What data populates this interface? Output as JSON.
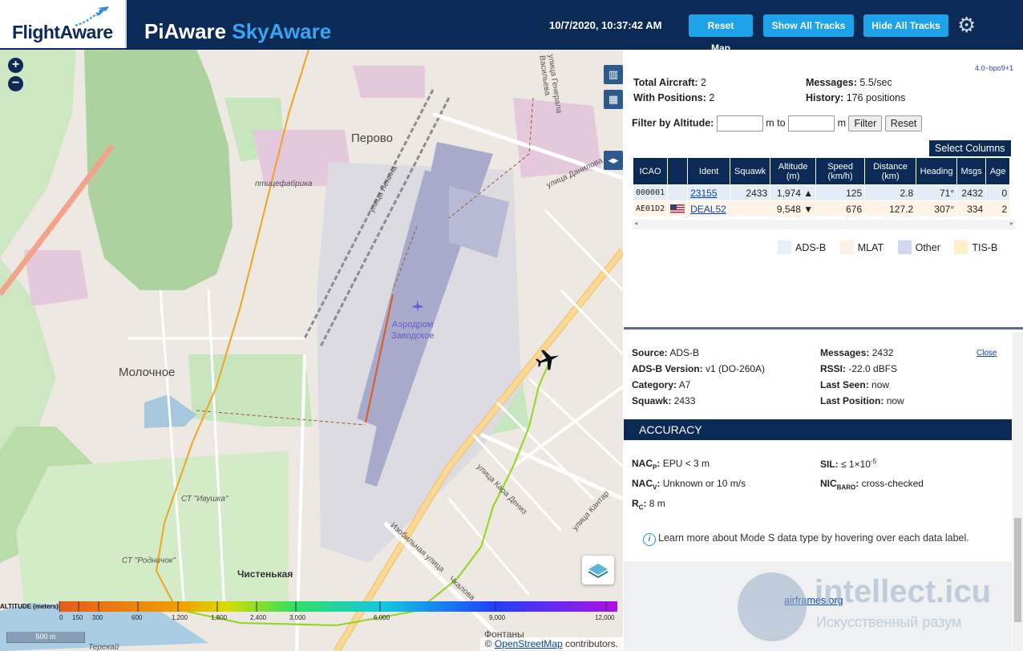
{
  "header": {
    "logo_text": "FlightAware",
    "title_a": "PiAware",
    "title_b": "SkyAware",
    "clock": "10/7/2020, 10:37:42 AM",
    "reset_map": "Reset Map",
    "show_all_tracks": "Show All Tracks",
    "hide_all_tracks": "Hide All Tracks"
  },
  "map": {
    "zoom_in": "+",
    "zoom_out": "−",
    "places": {
      "perovo": "Перово",
      "ptitsefabrika": "птицефабрика",
      "molochnoe": "Молочное",
      "ivushka": "СТ \"Ивушка\"",
      "rodnichok": "СТ \"Родничок\"",
      "chistenkaya": "Чистенькая",
      "fontany": "Фонтаны",
      "terekay": "Терекай"
    },
    "streets": {
      "lenina": "улица Ленина",
      "danilova": "улица Данилова",
      "vasileva": "улица Генерала Васильева",
      "karla_deniz": "улица Кара Дениз",
      "kantar": "улица Кантар",
      "izobilnaya": "Изобильная улица",
      "chkalova": "Чкалова"
    },
    "airport": [
      "Аэродром",
      "Заводское"
    ],
    "scale": "500 m",
    "attribution_prefix": "© ",
    "attribution_link": "OpenStreetMap",
    "attribution_suffix": " contributors.",
    "altitude_legend": {
      "title": "ALTITUDE (meters)",
      "ticks": [
        "0",
        "150",
        "300",
        "600",
        "1,200",
        "1,800",
        "2,400",
        "3,000",
        "6,000",
        "9,000",
        "12,000"
      ]
    }
  },
  "stats": {
    "version": "4.0~bpo9+1",
    "total_aircraft_label": "Total Aircraft:",
    "total_aircraft": "2",
    "with_positions_label": "With Positions:",
    "with_positions": "2",
    "messages_label": "Messages:",
    "messages": "5.5/sec",
    "history_label": "History:",
    "history": "176 positions"
  },
  "filter": {
    "label": "Filter by Altitude:",
    "unit1": "m to",
    "unit2": "m",
    "filter_btn": "Filter",
    "reset_btn": "Reset",
    "select_columns": "Select Columns"
  },
  "table": {
    "headers": [
      "ICAO",
      "",
      "Ident",
      "Squawk",
      "Altitude (m)",
      "Speed (km/h)",
      "Distance (km)",
      "Heading",
      "Msgs",
      "Age"
    ],
    "rows": [
      {
        "icao": "000001",
        "flag": "",
        "ident": "23155",
        "squawk": "2433",
        "altitude": "1,974 ▲",
        "speed": "125",
        "distance": "2.8",
        "heading": "71°",
        "msgs": "2432",
        "age": "0"
      },
      {
        "icao": "AE01D2",
        "flag": "US",
        "ident": "DEAL52",
        "squawk": "",
        "altitude": "9,548 ▼",
        "speed": "676",
        "distance": "127.2",
        "heading": "307°",
        "msgs": "334",
        "age": "2"
      }
    ]
  },
  "type_legend": [
    {
      "label": "ADS-B",
      "color": "#e4f1fb"
    },
    {
      "label": "MLAT",
      "color": "#fcefe4"
    },
    {
      "label": "Other",
      "color": "#d2d6f0"
    },
    {
      "label": "TIS-B",
      "color": "#fdf0c8"
    }
  ],
  "detail": {
    "close": "Close",
    "source_label": "Source:",
    "source": "ADS-B",
    "adsb_version_label": "ADS-B Version:",
    "adsb_version": "v1 (DO-260A)",
    "category_label": "Category:",
    "category": "A7",
    "squawk_label": "Squawk:",
    "squawk": "2433",
    "messages_label": "Messages:",
    "messages": "2432",
    "rssi_label": "RSSI:",
    "rssi": "-22.0 dBFS",
    "last_seen_label": "Last Seen:",
    "last_seen": "now",
    "last_position_label": "Last Position:",
    "last_position": "now",
    "accuracy_title": "ACCURACY",
    "nacp_label": "NAC",
    "nacp_sub": "P",
    "nacp": "EPU < 3 m",
    "nacv_label": "NAC",
    "nacv_sub": "V",
    "nacv": "Unknown or 10 m/s",
    "rc_label": "R",
    "rc_sub": "C",
    "rc": "8 m",
    "sil_label": "SIL:",
    "sil": "≤ 1×10",
    "sil_exp": "-5",
    "nicbaro_label": "NIC",
    "nicbaro_sub": "BARO",
    "nicbaro": "cross-checked",
    "info": "Learn more about Mode S data type by hovering over each data label.",
    "airframes": "airframes.org"
  },
  "watermark": {
    "title": "intellect.icu",
    "subtitle": "Искусственный разум"
  }
}
